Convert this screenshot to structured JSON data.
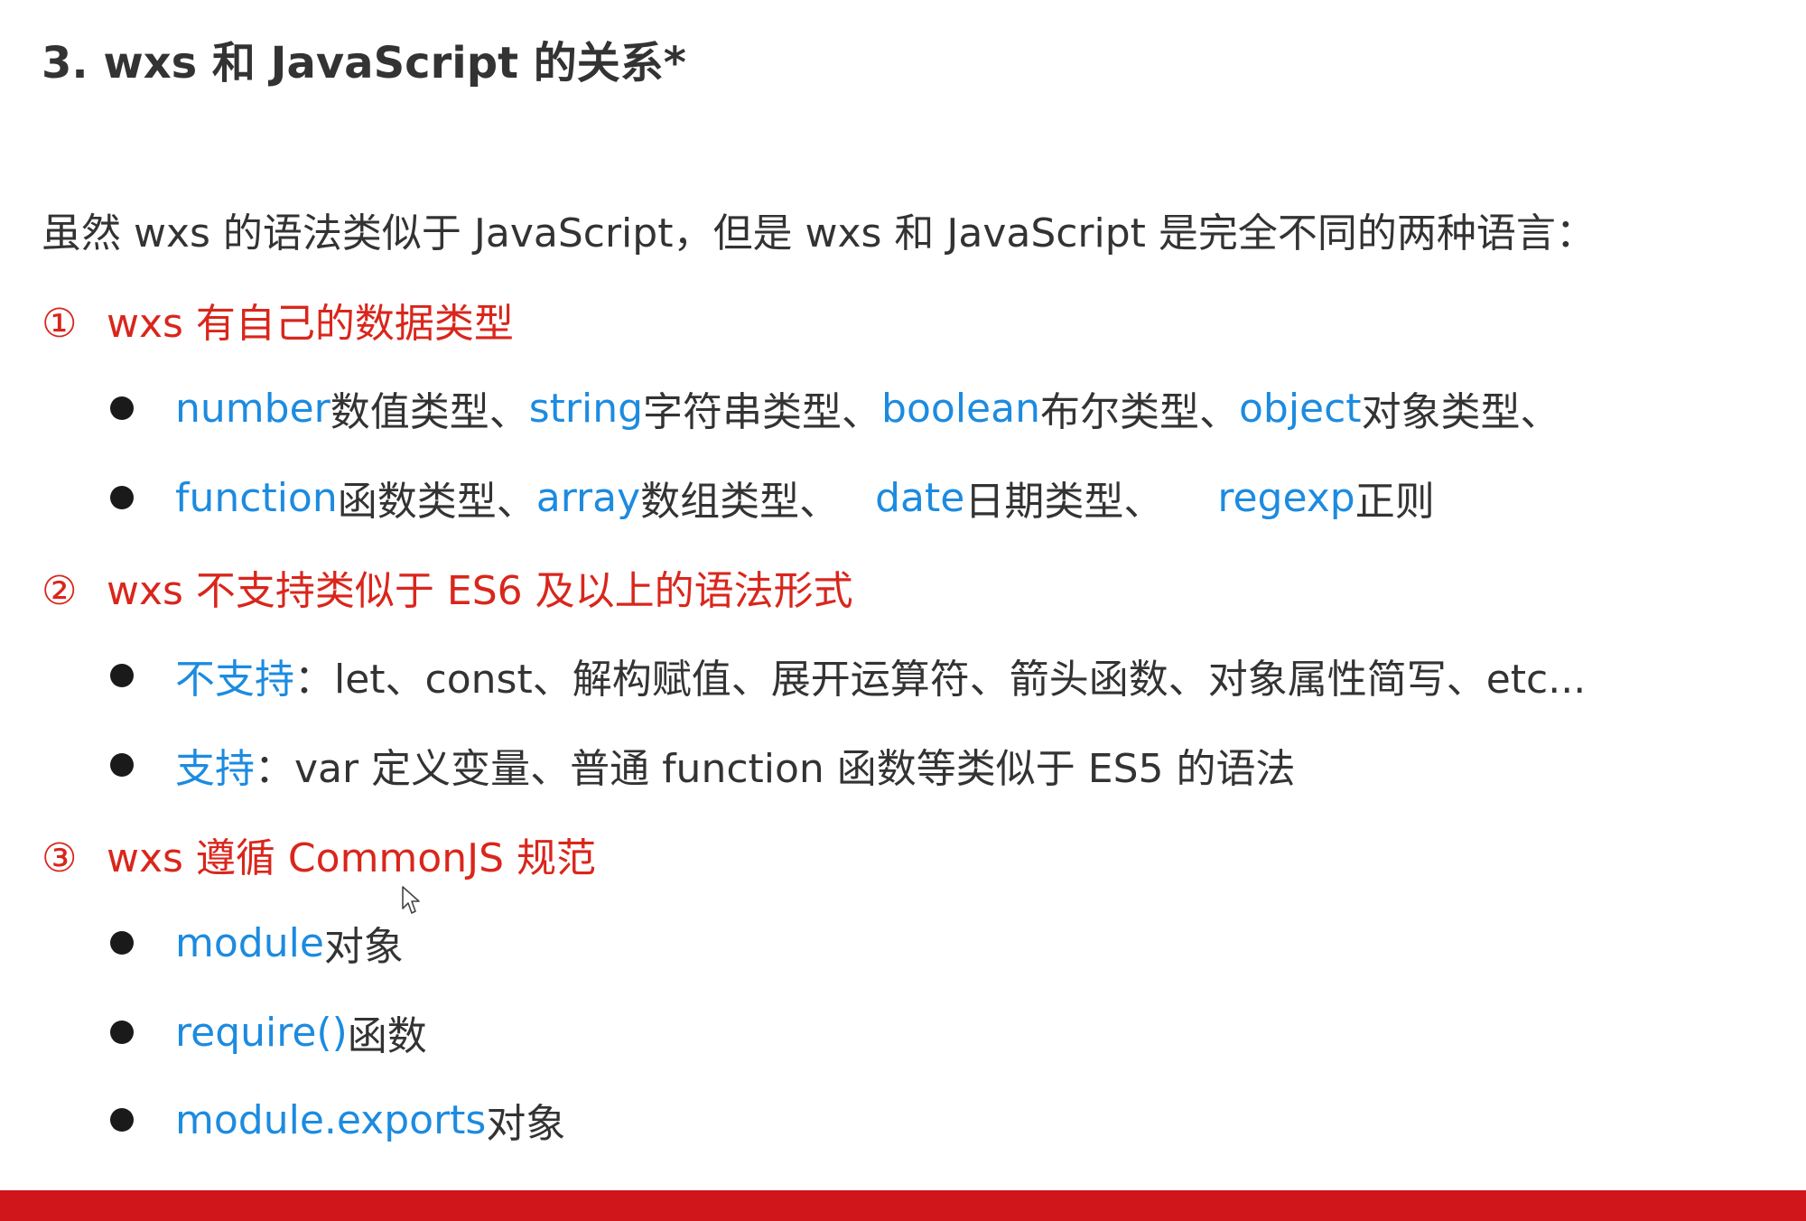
{
  "title": "3. wxs 和 JavaScript 的关系*",
  "intro": "虽然 wxs 的语法类似于 JavaScript，但是 wxs 和 JavaScript 是完全不同的两种语言：",
  "sections": [
    {
      "num": "①",
      "heading": "wxs 有自己的数据类型",
      "bullets": [
        [
          {
            "kw": "number",
            "text": " 数值类型、"
          },
          {
            "kw": "string",
            "text": " 字符串类型、"
          },
          {
            "kw": "boolean",
            "text": " 布尔类型、"
          },
          {
            "kw": "object",
            "text": " 对象类型、"
          }
        ],
        [
          {
            "kw": "function",
            "text": " 函数类型、"
          },
          {
            "kw": "array",
            "text": " 数组类型、"
          },
          {
            "kw": "date",
            "text": " 日期类型、"
          },
          {
            "kw": "regexp",
            "text": " 正则"
          }
        ]
      ]
    },
    {
      "num": "②",
      "heading": "wxs 不支持类似于 ES6 及以上的语法形式",
      "bullets": [
        [
          {
            "kw": "不支持",
            "text": "：let、const、解构赋值、展开运算符、箭头函数、对象属性简写、etc..."
          }
        ],
        [
          {
            "kw": "支持",
            "text": "：var 定义变量、普通 function 函数等类似于 ES5 的语法"
          }
        ]
      ]
    },
    {
      "num": "③",
      "heading": "wxs 遵循 CommonJS 规范",
      "bullets": [
        [
          {
            "kw": "module",
            "text": " 对象"
          }
        ],
        [
          {
            "kw": "require()",
            "text": " 函数"
          }
        ],
        [
          {
            "kw": "module.exports",
            "text": " 对象"
          }
        ]
      ]
    }
  ],
  "colors": {
    "heading_red": "#d9261c",
    "keyword_blue": "#1c8be0",
    "body_text": "#333333",
    "footer_bar": "#d0161b"
  }
}
